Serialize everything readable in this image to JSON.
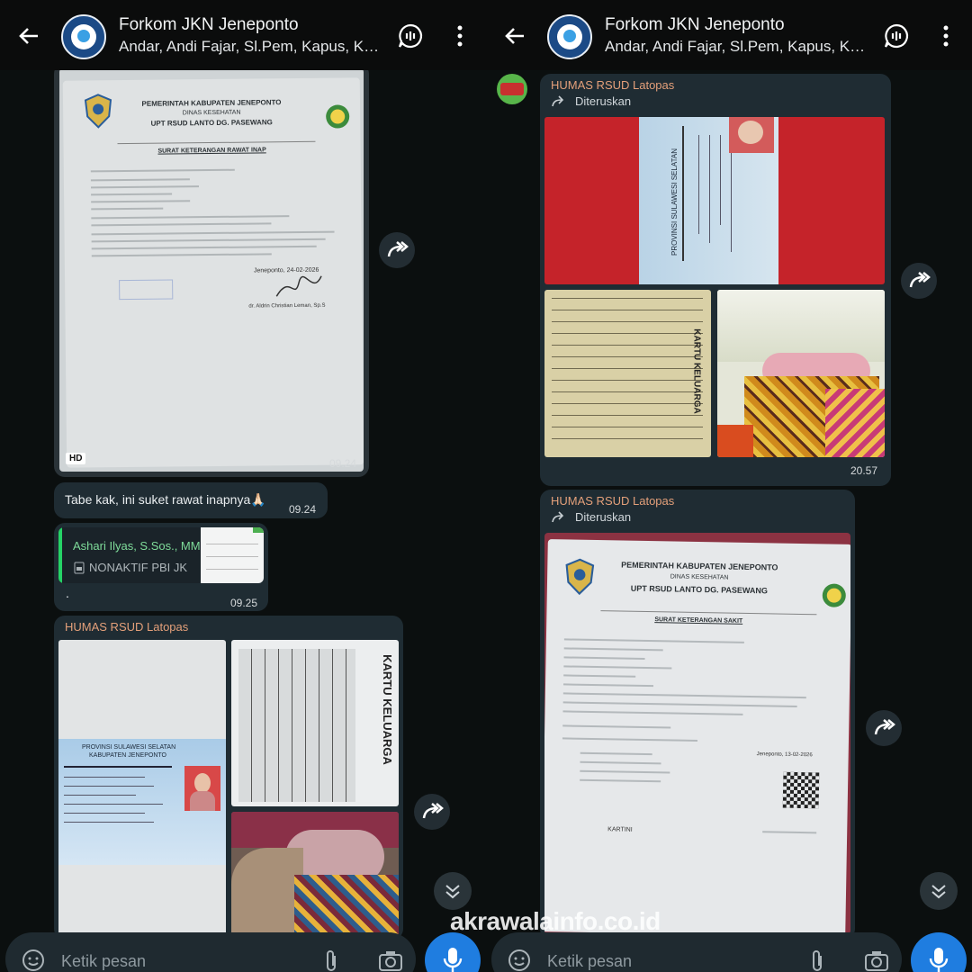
{
  "left": {
    "header": {
      "title": "Forkom JKN Jeneponto",
      "participants": "Andar, Andi Fajar, Sl.Pem, Kapus, Kapus ..."
    },
    "doc1": {
      "gov": "PEMERINTAH KABUPATEN JENEPONTO",
      "dinas": "DINAS KESEHATAN",
      "upt": "UPT RSUD LANTO DG. PASEWANG",
      "doc_title": "SURAT KETERANGAN RAWAT INAP",
      "place_date": "Jeneponto, 24-02-2026",
      "signer": "dr. Aldrin Christian Leman, Sp.S"
    },
    "msg_photo_badge": "HD",
    "msg_photo_time": "09.24",
    "msg_text": "Tabe kak, ini suket rawat inapnya🙏🏻",
    "msg_text_time": "09.24",
    "reply": {
      "author": "Ashari Ilyas, S.Sos., MM",
      "quoted": "NONAKTIF PBI JK",
      "body": ".",
      "time": "09.25"
    },
    "album": {
      "sender": "HUMAS RSUD Latopas",
      "ktp_province": "PROVINSI SULAWESI SELATAN",
      "ktp_regency": "KABUPATEN JENEPONTO",
      "kk_label": "KARTU KELUARGA"
    },
    "input_placeholder": "Ketik pesan"
  },
  "right": {
    "header": {
      "title": "Forkom JKN Jeneponto",
      "participants": "Andar, Andi Fajar, Sl.Pem, Kapus, Kapus ..."
    },
    "album": {
      "sender": "HUMAS RSUD Latopas",
      "forwarded": "Diteruskan",
      "ktp_province": "PROVINSI SULAWESI SELATAN",
      "kk_label": "KARTU KELUARGA",
      "time": "20.57"
    },
    "doc2": {
      "sender": "HUMAS RSUD Latopas",
      "forwarded": "Diteruskan",
      "gov": "PEMERINTAH KABUPATEN JENEPONTO",
      "dinas": "DINAS KESEHATAN",
      "upt": "UPT RSUD LANTO DG. PASEWANG",
      "doc_title": "SURAT KETERANGAN SAKIT",
      "place_date": "Jeneponto, 13-02-2026",
      "patient": "KARTINI"
    },
    "input_placeholder": "Ketik pesan"
  },
  "watermark": "akrawalainfo.co.id",
  "colors": {
    "bubble": "#1f2c33",
    "sender_name": "#e4a07a",
    "mic": "#1f7de0",
    "reply_bar": "#25d366"
  }
}
